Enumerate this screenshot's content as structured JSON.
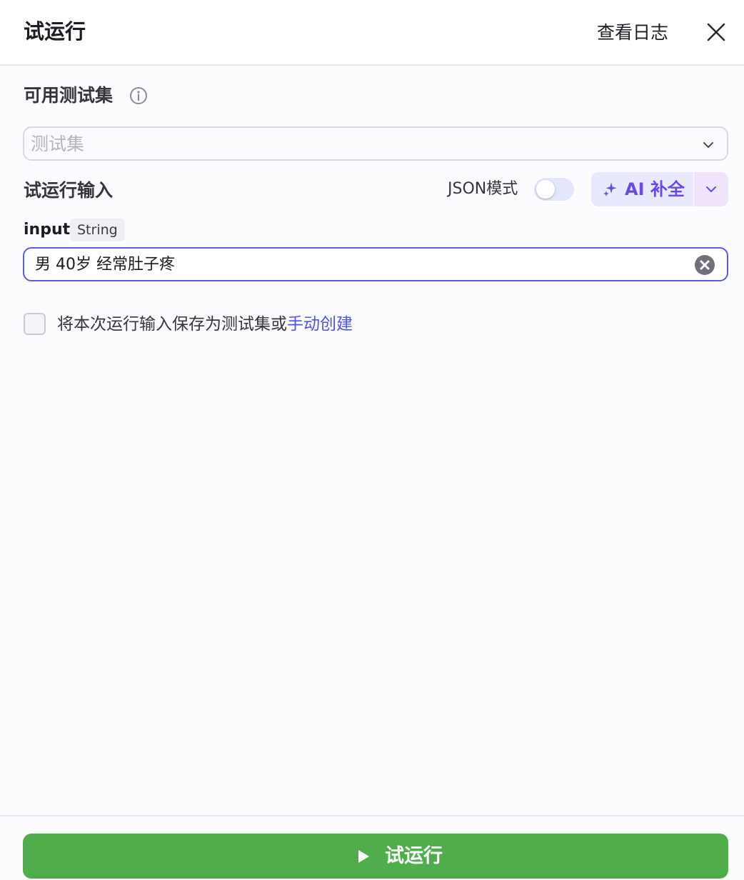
{
  "header": {
    "title": "试运行",
    "view_log": "查看日志"
  },
  "testset": {
    "label": "可用测试集",
    "placeholder": "测试集"
  },
  "run_input": {
    "label": "试运行输入",
    "json_mode_label": "JSON模式",
    "json_mode_on": false,
    "ai_complete_label": "AI 补全"
  },
  "param": {
    "name": "input",
    "type": "String",
    "value": "男 40岁 经常肚子疼"
  },
  "save_option": {
    "text": "将本次运行输入保存为测试集或",
    "link": "手动创建",
    "checked": false
  },
  "run_button": {
    "label": "试运行"
  },
  "colors": {
    "accent": "#5b5ce2",
    "run_green": "#4fad4c",
    "ai_purple": "#6b46e8",
    "link_blue": "#4d53e8"
  },
  "icons": [
    "close-icon",
    "info-icon",
    "chevron-down-icon",
    "sparkle-icon",
    "clear-icon",
    "play-icon"
  ]
}
